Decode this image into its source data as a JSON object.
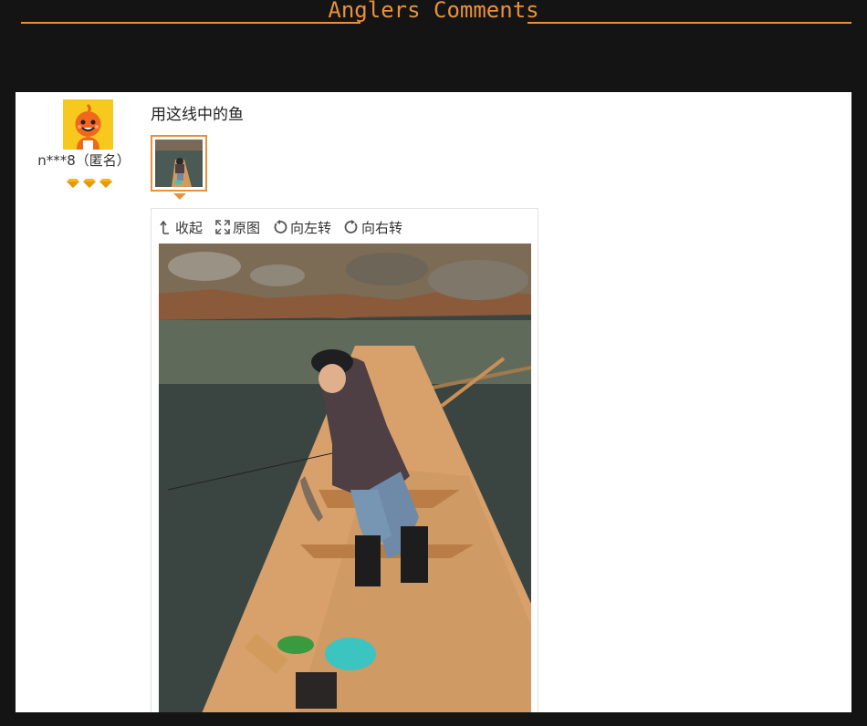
{
  "header": {
    "title": "Anglers Comments"
  },
  "review": {
    "username": "n***8（匿名）",
    "rank_icon": "diamond-icon",
    "rank_count": 3,
    "text": "用这线中的鱼",
    "toolbar": {
      "collapse_label": "收起",
      "original_label": "原图",
      "rotate_left_label": "向左转",
      "rotate_right_label": "向右转"
    }
  },
  "colors": {
    "accent": "#e8913a",
    "background": "#141414",
    "panel": "#ffffff"
  }
}
